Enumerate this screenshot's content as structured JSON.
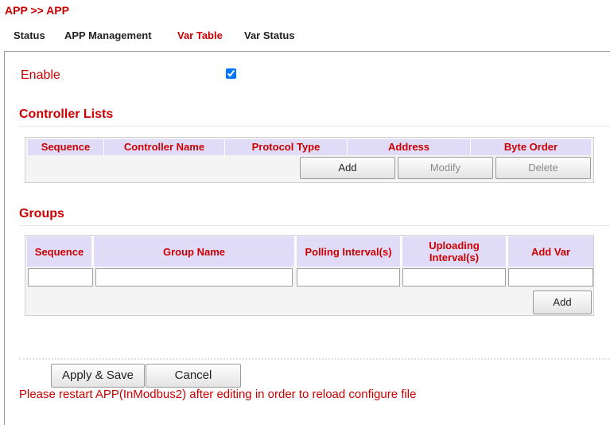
{
  "breadcrumb": "APP >> APP",
  "tabs": [
    {
      "label": "Status",
      "active": false
    },
    {
      "label": "APP Management",
      "active": false
    },
    {
      "label": "Var Table",
      "active": true
    },
    {
      "label": "Var Status",
      "active": false
    }
  ],
  "enable": {
    "label": "Enable",
    "checked": true
  },
  "controller_lists": {
    "title": "Controller Lists",
    "columns": [
      "Sequence",
      "Controller Name",
      "Protocol Type",
      "Address",
      "Byte Order"
    ],
    "buttons": {
      "add": "Add",
      "modify": "Modify",
      "delete": "Delete"
    }
  },
  "groups": {
    "title": "Groups",
    "columns": [
      "Sequence",
      "Group Name",
      "Polling Interval(s)",
      "Uploading Interval(s)",
      "Add Var"
    ],
    "inputs": [
      "",
      "",
      "",
      "",
      ""
    ],
    "add_button": "Add"
  },
  "actions": {
    "apply_save": "Apply & Save",
    "cancel": "Cancel"
  },
  "notice": "Please restart APP(InModbus2) after editing in order to reload configure file",
  "colors": {
    "accent": "#cc0000",
    "header_bg": "#e0dcf7",
    "table_bg": "#f4f4f4"
  }
}
